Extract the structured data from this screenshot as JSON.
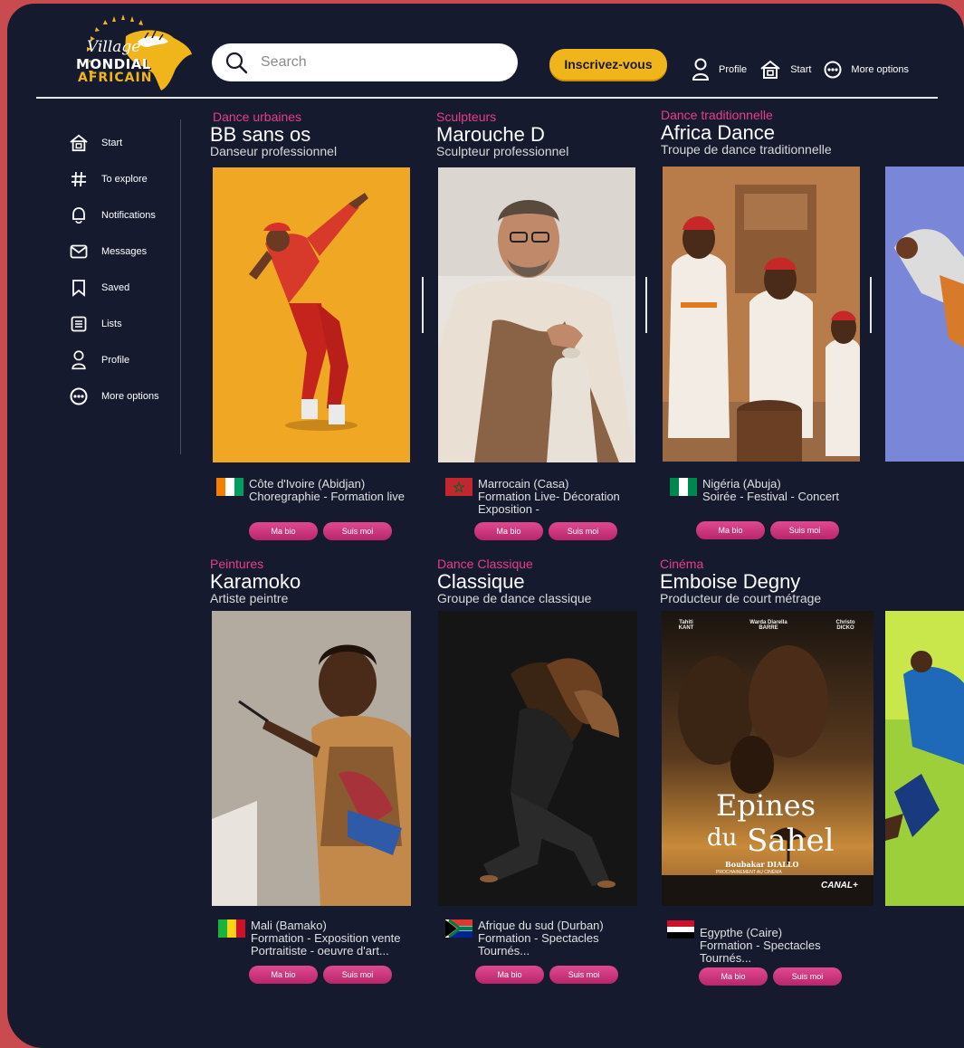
{
  "logo": {
    "line1": "Village",
    "line2": "MONDIAL",
    "line3": "AFRICAIN"
  },
  "search": {
    "placeholder": "Search"
  },
  "cta_label": "Inscrivez-vous",
  "topnav": [
    {
      "label": "Profile",
      "icon": "person-icon"
    },
    {
      "label": "Start",
      "icon": "home-icon"
    },
    {
      "label": "More options",
      "icon": "more-options-icon"
    }
  ],
  "sidebar": [
    {
      "label": "Start",
      "icon": "home-icon"
    },
    {
      "label": "To explore",
      "icon": "hashtag-icon"
    },
    {
      "label": "Notifications",
      "icon": "bell-icon"
    },
    {
      "label": "Messages",
      "icon": "envelope-icon"
    },
    {
      "label": "Saved",
      "icon": "bookmark-icon"
    },
    {
      "label": "Lists",
      "icon": "list-icon"
    },
    {
      "label": "Profile",
      "icon": "person-icon"
    },
    {
      "label": "More options",
      "icon": "more-options-icon"
    }
  ],
  "cards": [
    {
      "category": "Dance urbaines",
      "name": "BB sans os",
      "subtitle": "Danseur professionnel",
      "location": "Côte d'Ivoire (Abidjan)",
      "tags1": "Choregraphie - Formation live",
      "tags2": "",
      "flag": "ivory-coast-flag"
    },
    {
      "category": "Sculpteurs",
      "name": "Marouche D",
      "subtitle": "Sculpteur professionnel",
      "location": "Marrocain (Casa)",
      "tags1": "Formation Live- Décoration",
      "tags2": "Exposition -",
      "flag": "morocco-flag"
    },
    {
      "category": "Dance traditionnelle",
      "name": "Africa Dance",
      "subtitle": "Troupe de dance traditionnelle",
      "location": "Nigéria (Abuja)",
      "tags1": "Soirée  - Festival - Concert",
      "tags2": "",
      "flag": "nigeria-flag"
    },
    {
      "category": "Peintures",
      "name": "Karamoko",
      "subtitle": "Artiste peintre",
      "location": "Mali (Bamako)",
      "tags1": "Formation - Exposition vente",
      "tags2": "Portraitiste - oeuvre d'art...",
      "flag": "mali-flag"
    },
    {
      "category": "Dance Classique",
      "name": "Classique",
      "subtitle": "Groupe de dance classique",
      "location": "Afrique du sud (Durban)",
      "tags1": "Formation - Spectacles",
      "tags2": "Tournés...",
      "flag": "south-africa-flag"
    },
    {
      "category": "Cinéma",
      "name": "Emboise Degny",
      "subtitle": "Producteur de court métrage",
      "location": "Egypthe (Caire)",
      "tags1": "Formation - Spectacles",
      "tags2": "Tournés...",
      "flag": "egypt-flag"
    }
  ],
  "buttons": {
    "bio": "Ma bio",
    "follow": "Suis moi"
  },
  "poster": {
    "title1": "Epines",
    "title2": "du",
    "title3": "Sahel",
    "director": "Boubakar DIALLO",
    "actor1": "Tahiti KANT",
    "actor2": "Warda Diarella BARRE",
    "actor3": "Christo DICKO",
    "channel": "CANAL+",
    "tagline": "PROCHAINEMENT AU CINÉMA"
  },
  "colors": {
    "background": "#161a2e",
    "outer": "#c94b4f",
    "accent": "#e63d8e",
    "cta": "#f1b51c"
  }
}
